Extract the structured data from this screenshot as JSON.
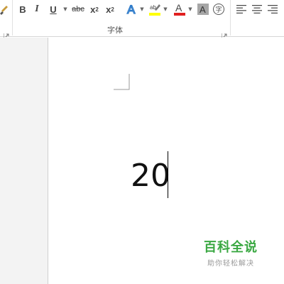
{
  "ribbon": {
    "font_group": {
      "label": "字体",
      "bold": "B",
      "italic": "I",
      "underline": "U",
      "strikethrough": "abc",
      "subscript_base": "x",
      "subscript_mark": "2",
      "superscript_base": "x",
      "superscript_mark": "2",
      "text_effect_icon": "text-effects-icon",
      "highlight_icon": "highlighter-icon",
      "font_color_icon": "font-color-icon",
      "highlight_color": "#ffff00",
      "font_color": "#e02020",
      "enclose_char": "字"
    },
    "paragraph_group": {
      "align_left_icon": "align-left-icon",
      "align_center_icon": "align-center-icon",
      "align_right_icon": "align-right-icon"
    }
  },
  "document": {
    "text": "20"
  },
  "watermark": {
    "main": "百科全说",
    "sub": "助你轻松解决",
    "color": "#3aa842"
  }
}
